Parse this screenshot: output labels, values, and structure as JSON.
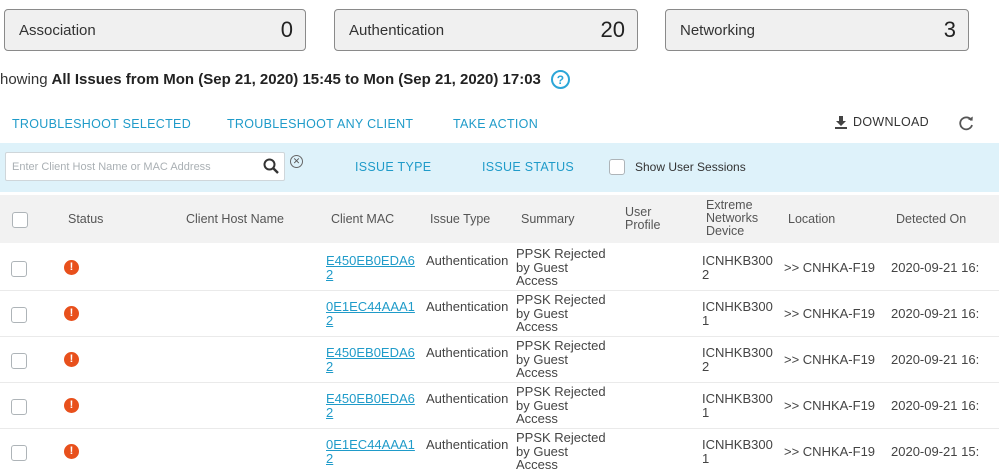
{
  "cards": [
    {
      "label": "Association",
      "count": "0"
    },
    {
      "label": "Authentication",
      "count": "20"
    },
    {
      "label": "Networking",
      "count": "3"
    }
  ],
  "range": {
    "prefix": "howing",
    "bold": "All Issues from Mon (Sep 21, 2020) 15:45 to Mon (Sep 21, 2020) 17:03",
    "help": "?"
  },
  "actions": {
    "troubleshoot_selected": "TROUBLESHOOT SELECTED",
    "troubleshoot_any": "TROUBLESHOOT ANY CLIENT",
    "take_action": "TAKE ACTION",
    "download": "DOWNLOAD"
  },
  "filter": {
    "search_placeholder": "Enter Client Host Name or MAC Address",
    "issue_type": "ISSUE TYPE",
    "issue_status": "ISSUE STATUS",
    "show_sessions": "Show User Sessions"
  },
  "columns": {
    "status": "Status",
    "host": "Client Host Name",
    "mac": "Client MAC",
    "issue_type": "Issue Type",
    "summary": "Summary",
    "user_profile": "User Profile",
    "device": "Extreme Networks Device",
    "location": "Location",
    "detected": "Detected On"
  },
  "rows": [
    {
      "mac": "E450EB0EDA62",
      "issue_type": "Authentication",
      "summary": "PPSK Rejected by Guest Access",
      "device": "ICNHKB3002",
      "location": ">> CNHKA-F19",
      "detected": "2020-09-21 16:"
    },
    {
      "mac": "0E1EC44AAA12",
      "issue_type": "Authentication",
      "summary": "PPSK Rejected by Guest Access",
      "device": "ICNHKB3001",
      "location": ">> CNHKA-F19",
      "detected": "2020-09-21 16:"
    },
    {
      "mac": "E450EB0EDA62",
      "issue_type": "Authentication",
      "summary": "PPSK Rejected by Guest Access",
      "device": "ICNHKB3002",
      "location": ">> CNHKA-F19",
      "detected": "2020-09-21 16:"
    },
    {
      "mac": "E450EB0EDA62",
      "issue_type": "Authentication",
      "summary": "PPSK Rejected by Guest Access",
      "device": "ICNHKB3001",
      "location": ">> CNHKA-F19",
      "detected": "2020-09-21 16:"
    },
    {
      "mac": "0E1EC44AAA12",
      "issue_type": "Authentication",
      "summary": "PPSK Rejected by Guest Access",
      "device": "ICNHKB3001",
      "location": ">> CNHKA-F19",
      "detected": "2020-09-21 15:"
    }
  ],
  "colors": {
    "accent": "#1f9bc9",
    "filter_bg": "#def2fa",
    "warning": "#e8501c"
  },
  "icons": {
    "search": "search-icon",
    "clear": "clear-icon",
    "download": "download-icon",
    "refresh": "refresh-icon",
    "warning": "warning-icon",
    "help": "help-icon"
  }
}
